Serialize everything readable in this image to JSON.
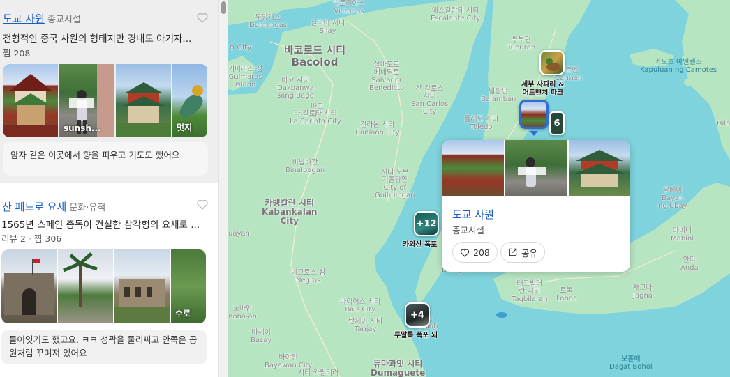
{
  "sidebar": {
    "places": [
      {
        "name": "도교 사원",
        "category": "종교시설",
        "description": "전형적인 중국 사원의 형태지만 경내도 아기자...",
        "stats": [
          "찜 208"
        ],
        "photo_label": "sunsh...",
        "photo_label2": "멋지",
        "review": "암자 같은 이곳에서 향을 피우고 기도도 했어요"
      },
      {
        "name": "산 페드로 요새",
        "category": "문화·유적",
        "description": "1565년 스페인 총독이 건설한 삼각형의 요새로 ...",
        "stats": [
          "리뷰 2",
          "찜 306"
        ],
        "photo_label": "수로",
        "review": "들어잇기도 했고요. ㅋㅋ 성곽을 둘러싸고 안쪽은 공원처럼 꾸며져 있어요"
      }
    ]
  },
  "map": {
    "labels": {
      "victorias": "빅토리아스\nVictorias",
      "escalante": "에스칼란테 시티\nEscalante City",
      "dumangas": "두망가스\nDumangas",
      "silay": "실라이 시티\nSilay",
      "o_city": "o City",
      "bacolod": "바코로드 시티\nBacolod",
      "tuburan": "투부란\nTuburan",
      "camotes": "카모츠 아일랜즈\nKapuluan ng Camotes",
      "guimaras": "기마라스 섬\nGuimaras\nIsland",
      "dakbanwa": "바고 시티\nDakbanwa\nsang Bago",
      "benedicto": "살바도르\n베네딕토\nSalvador\nBenedicto",
      "bago": "바고\n시티",
      "sancarlos": "산 칼로스\n시티\nSan Carlos\nCity",
      "balamban": "발람반\nBalamban",
      "lacarlota": "라 칼로타 시티\nLa Carlota City",
      "canlaon": "칸라온 시티\nCanlaon City",
      "toledo": "톨레도 시티\nToledo",
      "binalbagan": "비날바간\nBinalbagan",
      "guihulngan": "시티 오브\n기훌랑안\nCity of\nGuihulngan",
      "kabankalan": "카뱅칼란 시티\nKabankalan\nCity",
      "uayan": "uayan",
      "negros": "네그로스 섬\nNegros",
      "dalaguete": "Dalague",
      "tagbilaran": "태그빌러\n란 시티\nTagbilaran",
      "loboc": "로복\nLoboc",
      "jagna": "재그나\nJagna",
      "bayan": "우베이\nBayan\nng Ubay",
      "mabini": "마비니\nMabini",
      "anda": "안다\nAnda",
      "hilo": "Hilo",
      "bais": "바이어스 시티\nBais City",
      "tanjay": "탄제이 시티\nTanjay",
      "oslob": "ua\nOslob",
      "nobaan": "노바안\nnoba-an",
      "basay": "바세이\nBasay",
      "bayawan": "바야완\nBayawan City",
      "dumaguete": "듀마과잇 시티\nDumaguete",
      "dagat_bohol": "보홀해\nDagat Bohol",
      "cant": "시티 카릴리러",
      "carmen": "카르멘\nCarmen",
      "sub6": "6"
    },
    "markers": [
      {
        "label": "세부 사파리 &\n어드벤처 파크",
        "count": ""
      },
      {
        "label": "카와산 폭포",
        "count": "+12"
      },
      {
        "label": "투말록 폭포 외",
        "count": "+4"
      }
    ],
    "cluster_count": "6",
    "popup": {
      "title": "도교 사원",
      "category": "종교시설",
      "like_count": "208",
      "share_label": "공유"
    }
  },
  "colors": {
    "water": "#7fd3dc",
    "land": "#b7e5c2",
    "link": "#1a5fc6",
    "selected_border": "#2f6cd8"
  }
}
